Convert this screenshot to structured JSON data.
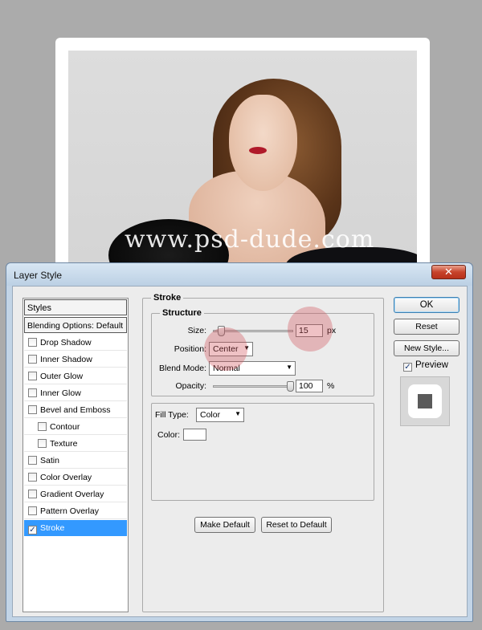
{
  "canvas": {
    "watermark": "www.psd-dude.com"
  },
  "dialog": {
    "title": "Layer Style",
    "close_label": "✕"
  },
  "styles_panel": {
    "header": "Styles",
    "blending_options": "Blending Options: Default",
    "items": [
      {
        "label": "Drop Shadow",
        "checked": false
      },
      {
        "label": "Inner Shadow",
        "checked": false
      },
      {
        "label": "Outer Glow",
        "checked": false
      },
      {
        "label": "Inner Glow",
        "checked": false
      },
      {
        "label": "Bevel and Emboss",
        "checked": false
      },
      {
        "label": "Contour",
        "checked": false,
        "sub": true
      },
      {
        "label": "Texture",
        "checked": false,
        "sub": true
      },
      {
        "label": "Satin",
        "checked": false
      },
      {
        "label": "Color Overlay",
        "checked": false
      },
      {
        "label": "Gradient Overlay",
        "checked": false
      },
      {
        "label": "Pattern Overlay",
        "checked": false
      },
      {
        "label": "Stroke",
        "checked": true,
        "selected": true
      }
    ]
  },
  "stroke": {
    "title": "Stroke",
    "structure_title": "Structure",
    "size_label": "Size:",
    "size_value": "15",
    "size_unit": "px",
    "size_slider_fraction": 0.06,
    "position_label": "Position:",
    "position_value": "Center",
    "blend_mode_label": "Blend Mode:",
    "blend_mode_value": "Normal",
    "opacity_label": "Opacity:",
    "opacity_value": "100",
    "opacity_unit": "%",
    "opacity_slider_fraction": 1.0,
    "fill_type_label": "Fill Type:",
    "fill_type_value": "Color",
    "color_label": "Color:",
    "stroke_color": "#ffffff",
    "make_default": "Make Default",
    "reset_to_default": "Reset to Default"
  },
  "right_buttons": {
    "ok": "OK",
    "reset": "Reset",
    "new_style": "New Style...",
    "preview_label": "Preview",
    "preview_checked": true
  },
  "colors": {
    "selection": "#3399ff",
    "highlight": "#d2505a"
  }
}
